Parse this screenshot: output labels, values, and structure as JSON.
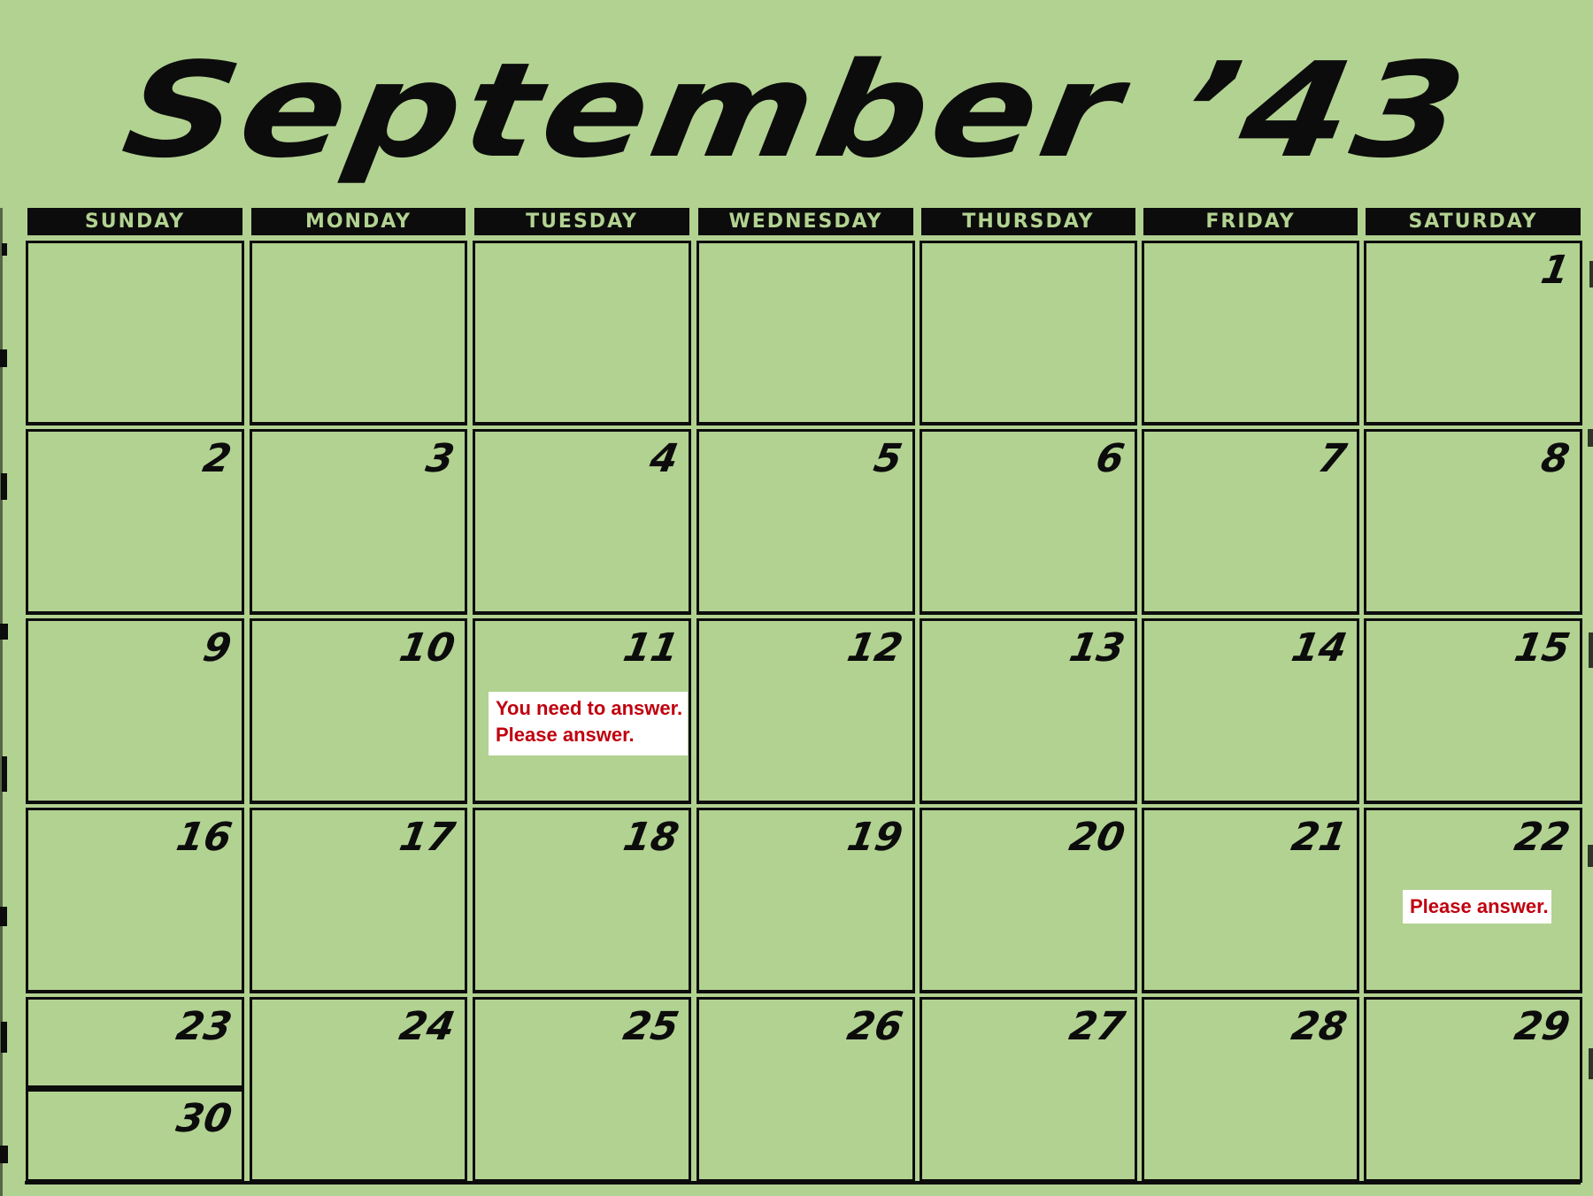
{
  "title": "September ’43",
  "weekdays": [
    "SUNDAY",
    "MONDAY",
    "TUESDAY",
    "WEDNESDAY",
    "THURSDAY",
    "FRIDAY",
    "SATURDAY"
  ],
  "dates": [
    "1",
    "2",
    "3",
    "4",
    "5",
    "6",
    "7",
    "8",
    "9",
    "10",
    "11",
    "12",
    "13",
    "14",
    "15",
    "16",
    "17",
    "18",
    "19",
    "20",
    "21",
    "22",
    "23",
    "24",
    "25",
    "26",
    "27",
    "28",
    "29",
    "30"
  ],
  "notes": {
    "sept_11": [
      "You need to answer.",
      "Please answer."
    ],
    "sept_22": [
      "Please answer."
    ]
  },
  "colors": {
    "background": "#b2d291",
    "ink": "#0c0c0c",
    "note_text": "#c0000e",
    "note_bg": "#ffffff"
  }
}
